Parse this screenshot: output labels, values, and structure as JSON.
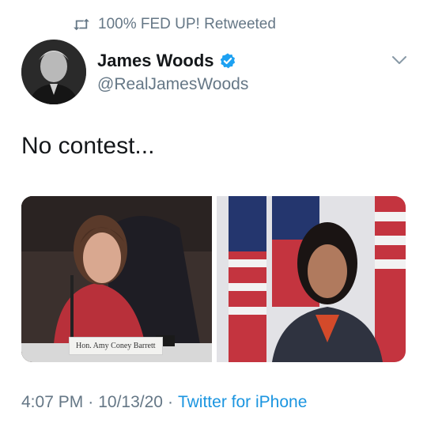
{
  "retweet": {
    "label": "100% FED UP! Retweeted",
    "icon": "retweet-icon"
  },
  "author": {
    "display_name": "James Woods",
    "handle": "@RealJamesWoods",
    "verified_icon": "verified-badge-icon",
    "avatar": "avatar"
  },
  "menu": {
    "icon": "chevron-down-icon"
  },
  "tweet": {
    "text": "No contest...",
    "media": {
      "left_caption": "Hon. Amy Coney Barrett"
    }
  },
  "meta": {
    "time": "4:07 PM",
    "date": "10/13/20",
    "separator": "·",
    "source": "Twitter for iPhone"
  },
  "colors": {
    "text": "#14171a",
    "muted": "#657786",
    "link": "#1b95e0",
    "verified": "#1da1f2"
  }
}
